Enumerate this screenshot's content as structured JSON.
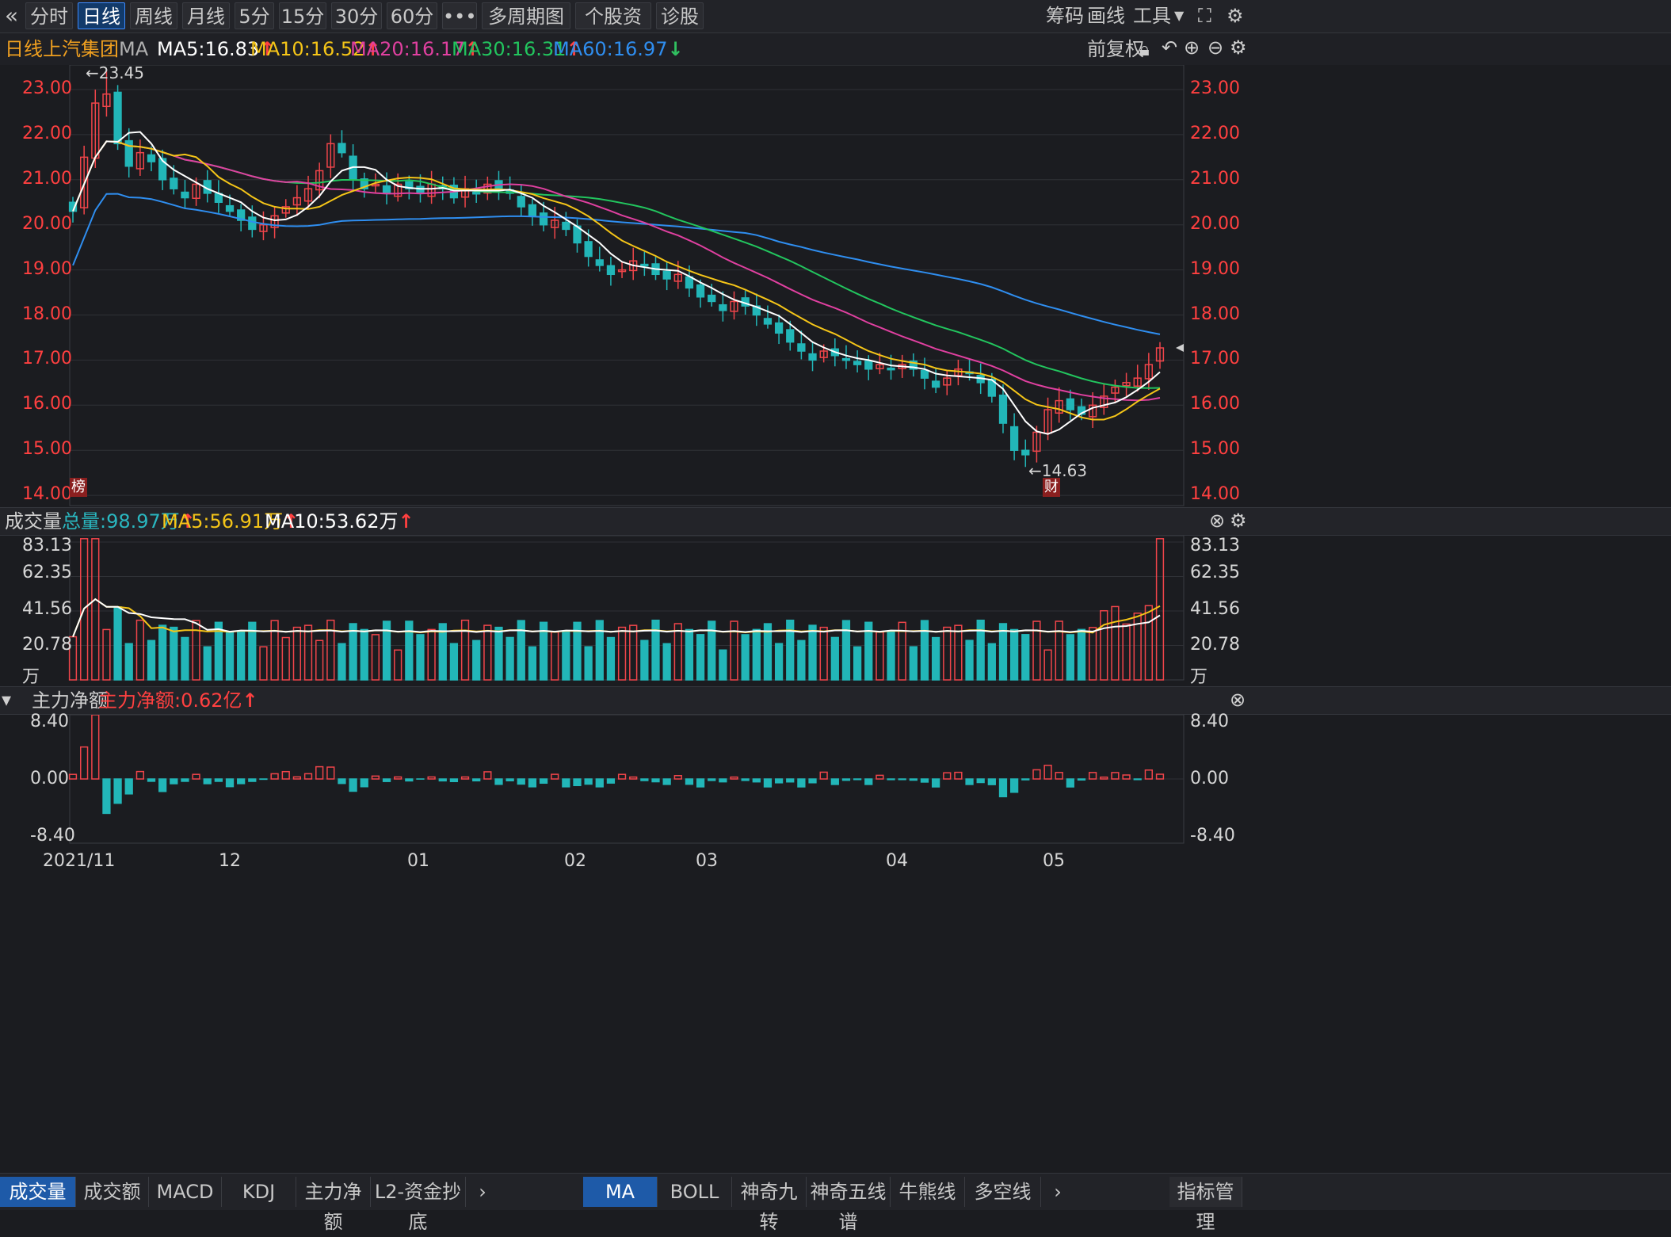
{
  "toolbar": {
    "back_icon": "chevron-double-left-icon",
    "periods": [
      "分时",
      "日线",
      "周线",
      "月线",
      "5分",
      "15分",
      "30分",
      "60分"
    ],
    "active_period": "日线",
    "more_label": "•••",
    "multi_period_label": "多周期图",
    "stock_profile_label": "个股资料",
    "diagnose_label": "诊股",
    "chips_label": "筹码",
    "draw_label": "画线",
    "tools_label": "工具"
  },
  "info": {
    "period": "日线",
    "stock_name": "上汽集团",
    "indicator": "MA",
    "ma5": "MA5:16.83",
    "ma10": "MA10:16.52",
    "ma20": "MA20:16.17",
    "ma30": "MA30:16.31",
    "ma60": "MA60:16.97",
    "adjust_label": "前复权",
    "colors": {
      "ma5": "#ffffff",
      "ma10": "#f5c518",
      "ma20": "#e040a0",
      "ma30": "#22c55e",
      "ma60": "#2f8ef0"
    }
  },
  "price_axis": [
    "23.00",
    "22.00",
    "21.00",
    "20.00",
    "19.00",
    "18.00",
    "17.00",
    "16.00",
    "15.00",
    "14.00"
  ],
  "price_annotations": {
    "high": "←23.45",
    "low": "←14.63"
  },
  "badges": {
    "list_badge": "榜",
    "finance_badge": "财"
  },
  "volume": {
    "title": "成交量",
    "total": "总量:98.97万",
    "ma5": "MA5:56.91万",
    "ma10": "MA10:53.62万",
    "axis": [
      "83.13",
      "62.35",
      "41.56",
      "20.78",
      "万"
    ]
  },
  "netflow": {
    "title": "主力净额",
    "value": "主力净额:0.62亿",
    "axis": [
      "8.40",
      "0.00",
      "-8.40"
    ]
  },
  "date_axis": [
    "2021/11",
    "12",
    "01",
    "02",
    "03",
    "04",
    "05"
  ],
  "bottom_tabs": {
    "left": [
      "成交量",
      "成交额",
      "MACD",
      "KDJ",
      "主力净额",
      "L2-资金抄底"
    ],
    "left_active": "成交量",
    "right": [
      "MA",
      "BOLL",
      "神奇九转",
      "神奇五线谱",
      "牛熊线",
      "多空线"
    ],
    "right_active": "MA",
    "manage_label": "指标管理"
  },
  "chart_data": [
    {
      "type": "candlestick",
      "title": "上汽集团 日线",
      "ylim": [
        14.0,
        23.45
      ],
      "x_ticks": [
        "2021/11",
        "12",
        "01",
        "02",
        "03",
        "04",
        "05"
      ],
      "key_values": {
        "max_high": 23.45,
        "min_low": 14.63,
        "last_close": 17.27
      },
      "close_path": [
        20.3,
        21.5,
        22.7,
        22.9,
        21.8,
        21.3,
        21.6,
        21.4,
        21.0,
        20.8,
        20.6,
        20.9,
        20.7,
        20.5,
        20.3,
        20.1,
        19.9,
        20.0,
        20.2,
        20.4,
        20.6,
        20.8,
        21.2,
        21.8,
        21.6,
        21.0,
        20.8,
        20.9,
        20.7,
        20.9,
        20.8,
        20.7,
        20.9,
        20.8,
        20.6,
        20.8,
        20.7,
        20.9,
        20.8,
        20.7,
        20.4,
        20.2,
        20.0,
        20.1,
        19.9,
        19.6,
        19.3,
        19.1,
        18.9,
        19.0,
        19.2,
        19.1,
        18.9,
        18.8,
        18.9,
        18.6,
        18.4,
        18.3,
        18.1,
        18.3,
        18.2,
        18.0,
        17.8,
        17.6,
        17.4,
        17.2,
        17.0,
        17.2,
        17.1,
        17.0,
        16.9,
        16.8,
        16.9,
        16.8,
        16.9,
        16.8,
        16.6,
        16.4,
        16.6,
        16.8,
        16.7,
        16.5,
        16.2,
        15.6,
        15.0,
        14.9,
        15.4,
        15.9,
        16.1,
        15.9,
        15.8,
        16.0,
        16.2,
        16.4,
        16.5,
        16.6,
        16.9,
        17.27
      ]
    },
    {
      "type": "bar",
      "title": "成交量",
      "unit": "万",
      "ylim": [
        0,
        83.13
      ],
      "total_last": 98.97,
      "ma5_last": 56.91,
      "ma10_last": 53.62
    },
    {
      "type": "bar",
      "title": "主力净额",
      "unit": "亿",
      "ylim": [
        -8.4,
        8.4
      ],
      "last": 0.62
    }
  ]
}
